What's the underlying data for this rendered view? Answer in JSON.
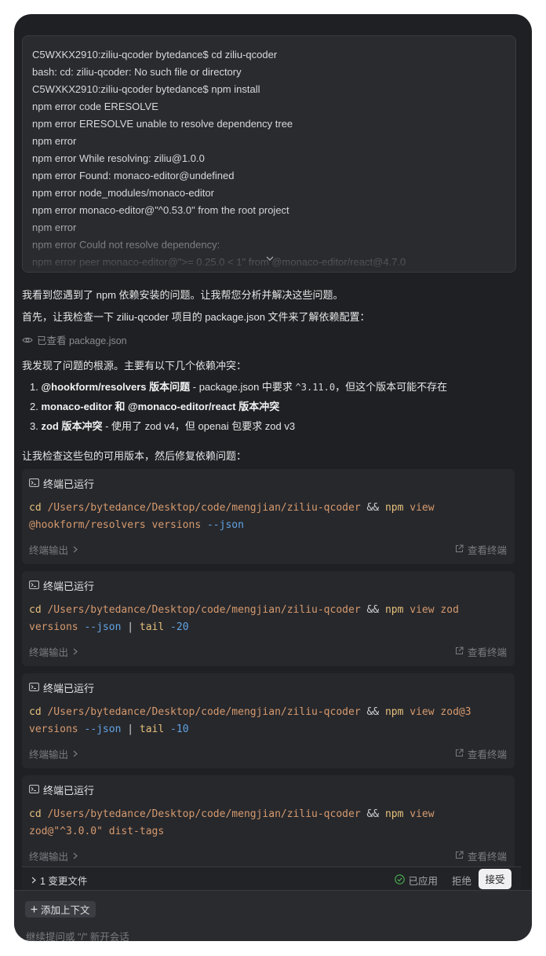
{
  "user_message": {
    "lines": [
      "C5WXKX2910:ziliu-qcoder bytedance$ cd ziliu-qcoder",
      "bash: cd: ziliu-qcoder: No such file or directory",
      "C5WXKX2910:ziliu-qcoder bytedance$ npm install",
      "npm error code ERESOLVE",
      "npm error ERESOLVE unable to resolve dependency tree",
      "npm error",
      "npm error While resolving: ziliu@1.0.0",
      "npm error Found: monaco-editor@undefined",
      "npm error node_modules/monaco-editor",
      "npm error monaco-editor@\"^0.53.0\" from the root project",
      "npm error",
      "npm error Could not resolve dependency:",
      "npm error peer monaco-editor@\">= 0.25.0 < 1\" from @monaco-editor/react@4.7.0"
    ],
    "expand_icon": "chevron-down-icon"
  },
  "assistant": {
    "intro": "我看到您遇到了 npm 依赖安装的问题。让我帮您分析并解决这些问题。",
    "step1": "首先，让我检查一下 ziliu-qcoder 项目的 package.json 文件来了解依赖配置：",
    "viewed": {
      "icon": "eye-icon",
      "label": "已查看 package.json"
    },
    "found": "我发现了问题的根源。主要有以下几个依赖冲突：",
    "issues": [
      {
        "num": "1.",
        "bold": "@hookform/resolvers 版本问题",
        "rest_a": " - package.json 中要求 ",
        "code": "^3.11.0",
        "rest_b": "，但这个版本可能不存在"
      },
      {
        "num": "2.",
        "bold": "monaco-editor 和 @monaco-editor/react 版本冲突",
        "rest_a": "",
        "code": "",
        "rest_b": ""
      },
      {
        "num": "3.",
        "bold": "zod 版本冲突",
        "rest_a": " - 使用了 zod v4，但 openai 包要求 zod v3",
        "code": "",
        "rest_b": ""
      }
    ],
    "next": "让我检查这些包的可用版本，然后修复依赖问题："
  },
  "terminals": [
    {
      "title": "终端已运行",
      "line1": [
        {
          "c": "c-kw",
          "t": "cd"
        },
        {
          "c": "c-plain",
          "t": " "
        },
        {
          "c": "c-path",
          "t": "/Users/bytedance/Desktop/code/mengjian/ziliu-qcoder"
        },
        {
          "c": "c-plain",
          "t": " && "
        },
        {
          "c": "c-kw",
          "t": "npm"
        },
        {
          "c": "c-path",
          "t": " view"
        }
      ],
      "line2": [
        {
          "c": "c-path",
          "t": "@hookform/resolvers versions "
        },
        {
          "c": "c-flag",
          "t": "--json"
        }
      ],
      "output": "终端输出",
      "view": "查看终端"
    },
    {
      "title": "终端已运行",
      "line1": [
        {
          "c": "c-kw",
          "t": "cd"
        },
        {
          "c": "c-plain",
          "t": " "
        },
        {
          "c": "c-path",
          "t": "/Users/bytedance/Desktop/code/mengjian/ziliu-qcoder"
        },
        {
          "c": "c-plain",
          "t": " && "
        },
        {
          "c": "c-kw",
          "t": "npm"
        },
        {
          "c": "c-path",
          "t": " view zod"
        }
      ],
      "line2": [
        {
          "c": "c-path",
          "t": "versions "
        },
        {
          "c": "c-flag",
          "t": "--json"
        },
        {
          "c": "c-plain",
          "t": " | "
        },
        {
          "c": "c-kw",
          "t": "tail"
        },
        {
          "c": "c-plain",
          "t": " "
        },
        {
          "c": "c-num",
          "t": "-20"
        }
      ],
      "output": "终端输出",
      "view": "查看终端"
    },
    {
      "title": "终端已运行",
      "line1": [
        {
          "c": "c-kw",
          "t": "cd"
        },
        {
          "c": "c-plain",
          "t": " "
        },
        {
          "c": "c-path",
          "t": "/Users/bytedance/Desktop/code/mengjian/ziliu-qcoder"
        },
        {
          "c": "c-plain",
          "t": " && "
        },
        {
          "c": "c-kw",
          "t": "npm"
        },
        {
          "c": "c-path",
          "t": " view zod@3"
        }
      ],
      "line2": [
        {
          "c": "c-path",
          "t": "versions "
        },
        {
          "c": "c-flag",
          "t": "--json"
        },
        {
          "c": "c-plain",
          "t": " | "
        },
        {
          "c": "c-kw",
          "t": "tail"
        },
        {
          "c": "c-plain",
          "t": " "
        },
        {
          "c": "c-num",
          "t": "-10"
        }
      ],
      "output": "终端输出",
      "view": "查看终端"
    },
    {
      "title": "终端已运行",
      "line1": [
        {
          "c": "c-kw",
          "t": "cd"
        },
        {
          "c": "c-plain",
          "t": " "
        },
        {
          "c": "c-path",
          "t": "/Users/bytedance/Desktop/code/mengjian/ziliu-qcoder"
        },
        {
          "c": "c-plain",
          "t": " && "
        },
        {
          "c": "c-kw",
          "t": "npm"
        },
        {
          "c": "c-path",
          "t": " view"
        }
      ],
      "line2": [
        {
          "c": "c-path",
          "t": "zod@\"^3.0.0\" dist-tags"
        }
      ],
      "output": "终端输出",
      "view": "查看终端"
    }
  ],
  "changes": {
    "label": "1 变更文件",
    "applied": "已应用",
    "reject": "拒绝",
    "accept": "接受"
  },
  "composer": {
    "add_context": "添加上下文",
    "placeholder": "继续提问或 \"/\" 新开会话"
  },
  "colors": {
    "background": "#1f2023",
    "card": "#27282c",
    "keyword": "#e5c07b",
    "path": "#d69a6e",
    "flag": "#61a4e4",
    "applied_green": "#4caf50"
  }
}
